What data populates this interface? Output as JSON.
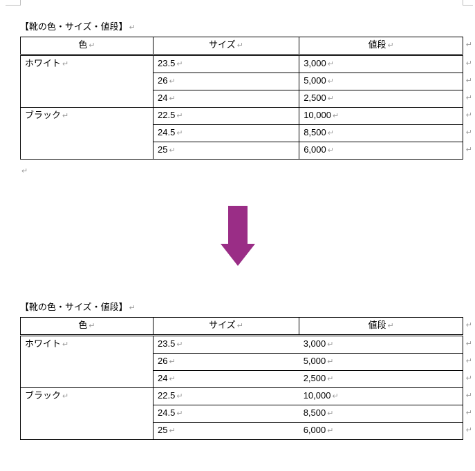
{
  "glyphs": {
    "return": "↵",
    "row_end": "↵"
  },
  "arrow_color": "#9a2d86",
  "section_title": "【靴の色・サイズ・値段】",
  "headers": {
    "color": "色",
    "size": "サイズ",
    "price": "値段"
  },
  "table1": {
    "rows": [
      {
        "color": "ホワイト",
        "size": "23.5",
        "price": "3,000",
        "rowspan": 3
      },
      {
        "color": null,
        "size": "26",
        "price": "5,000"
      },
      {
        "color": null,
        "size": "24",
        "price": "2,500"
      },
      {
        "color": "ブラック",
        "size": "22.5",
        "price": "10,000",
        "rowspan": 3
      },
      {
        "color": null,
        "size": "24.5",
        "price": "8,500"
      },
      {
        "color": null,
        "size": "25",
        "price": "6,000"
      }
    ]
  },
  "table2": {
    "rows": [
      {
        "color": "ホワイト",
        "size": "23.5",
        "price": "3,000",
        "rowspan": 3
      },
      {
        "color": null,
        "size": "26",
        "price": "5,000"
      },
      {
        "color": null,
        "size": "24",
        "price": "2,500"
      },
      {
        "color": "ブラック",
        "size": "22.5",
        "price": "10,000",
        "rowspan": 3
      },
      {
        "color": null,
        "size": "24.5",
        "price": "8,500"
      },
      {
        "color": null,
        "size": "25",
        "price": "6,000"
      }
    ]
  }
}
